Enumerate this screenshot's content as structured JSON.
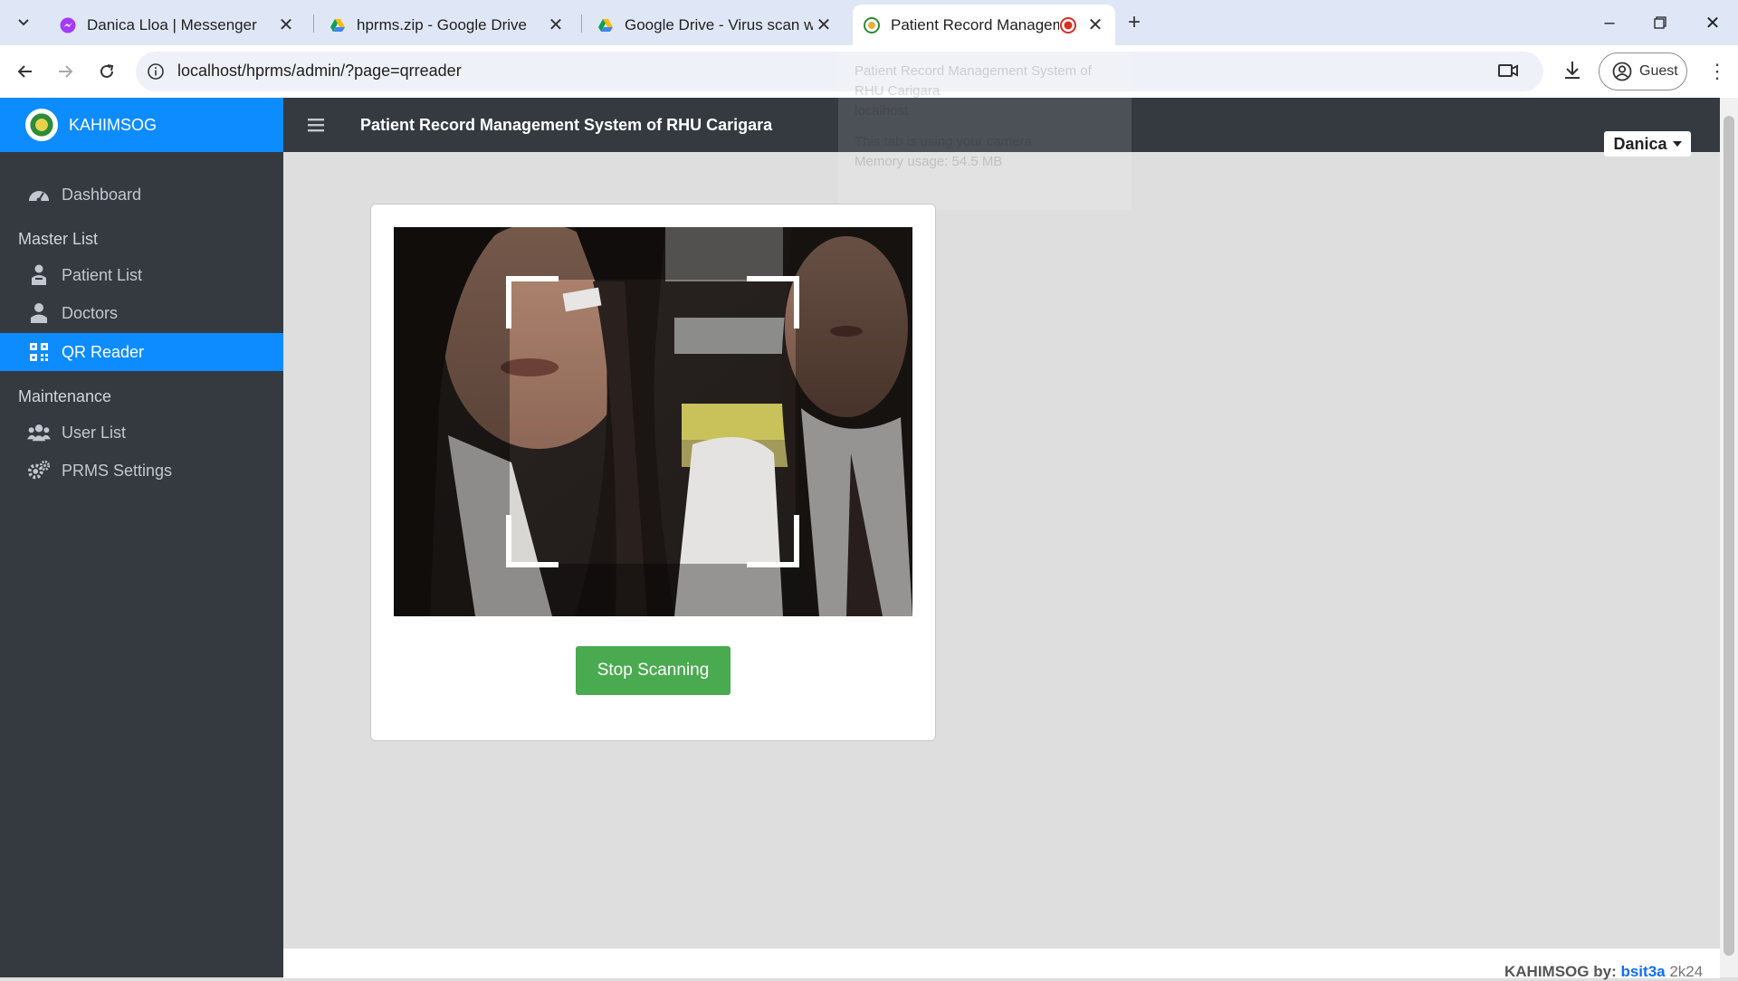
{
  "browser": {
    "tabs": [
      {
        "title": "Danica Lloa | Messenger",
        "icon": "messenger-icon"
      },
      {
        "title": "hprms.zip - Google Drive",
        "icon": "google-drive-icon"
      },
      {
        "title": "Google Drive - Virus scan warni",
        "icon": "google-drive-icon"
      },
      {
        "title": "Patient Record Managemen",
        "icon": "site-favicon",
        "active": true
      }
    ],
    "url": "localhost/hprms/admin/?page=qrreader",
    "guest_label": "Guest"
  },
  "notification": {
    "title": "Patient Record Management System of RHU Carigara",
    "origin": "localhost",
    "line1": "This tab is using your camera",
    "line2": "Memory usage: 54.5 MB"
  },
  "sidebar": {
    "brand": "KAHIMSOG",
    "items": [
      {
        "label": "Dashboard",
        "icon": "dashboard-icon"
      },
      {
        "label": "Patient List",
        "icon": "patient-icon"
      },
      {
        "label": "Doctors",
        "icon": "doctor-icon"
      },
      {
        "label": "QR Reader",
        "icon": "qr-code-icon",
        "active": true
      },
      {
        "label": "User List",
        "icon": "users-icon"
      },
      {
        "label": "PRMS Settings",
        "icon": "settings-icon"
      }
    ],
    "headers": {
      "master": "Master List",
      "maintenance": "Maintenance"
    }
  },
  "header": {
    "title": "Patient Record Management System of RHU Carigara",
    "user": "Danica"
  },
  "scanner": {
    "stop_label": "Stop Scanning"
  },
  "footer": {
    "brand": "KAHIMSOG",
    "by": "by:",
    "author": "bsit3a",
    "year": "2k24"
  },
  "colors": {
    "accent": "#0d8cff",
    "sidebar": "#343a40",
    "button": "#4aaa4f"
  }
}
